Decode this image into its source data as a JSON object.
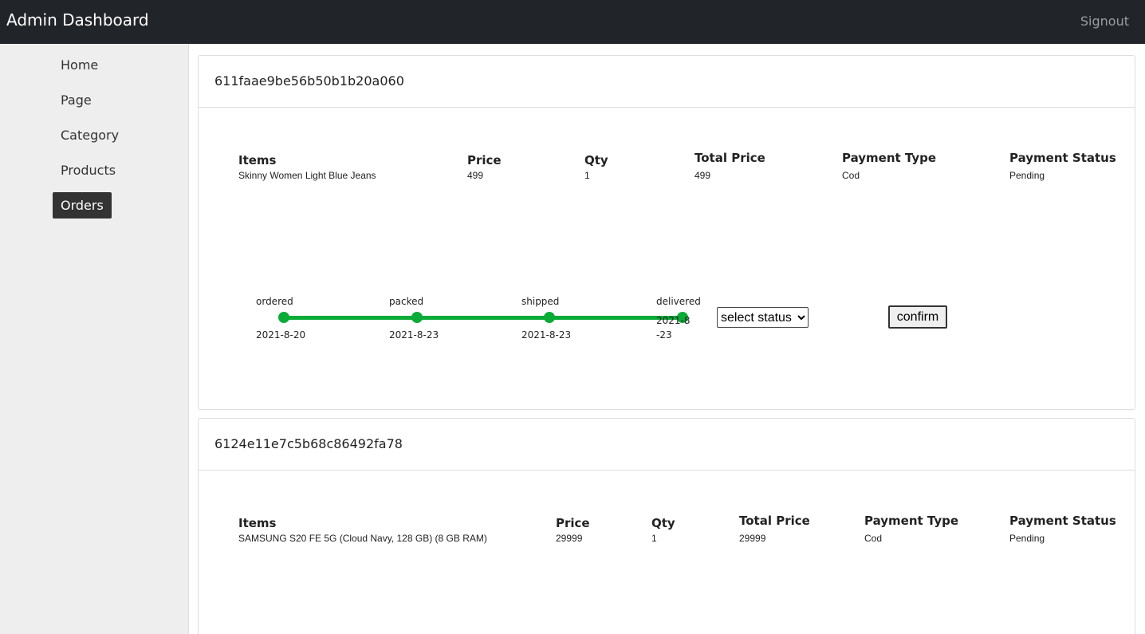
{
  "header": {
    "title": "Admin Dashboard",
    "signout_label": "Signout"
  },
  "sidebar": {
    "items": [
      {
        "label": "Home",
        "active": false
      },
      {
        "label": "Page",
        "active": false
      },
      {
        "label": "Category",
        "active": false
      },
      {
        "label": "Products",
        "active": false
      },
      {
        "label": "Orders",
        "active": true
      }
    ]
  },
  "columns": {
    "items": "Items",
    "price": "Price",
    "qty": "Qty",
    "total_price": "Total Price",
    "payment_type": "Payment Type",
    "payment_status": "Payment Status"
  },
  "orders": [
    {
      "id": "611faae9be56b50b1b20a060",
      "item_name": "Skinny Women Light Blue Jeans",
      "price": "499",
      "qty": "1",
      "total_price": "499",
      "payment_type": "Cod",
      "payment_status": "Pending",
      "tracking": [
        {
          "label": "ordered",
          "date": "2021-8-20"
        },
        {
          "label": "packed",
          "date": "2021-8-23"
        },
        {
          "label": "shipped",
          "date": "2021-8-23"
        },
        {
          "label": "delivered",
          "date": "2021-8-23"
        }
      ],
      "select_placeholder": "select status",
      "confirm_label": "confirm"
    },
    {
      "id": "6124e11e7c5b68c86492fa78",
      "item_name": "SAMSUNG S20 FE 5G (Cloud Navy, 128 GB) (8 GB RAM)",
      "price": "29999",
      "qty": "1",
      "total_price": "29999",
      "payment_type": "Cod",
      "payment_status": "Pending"
    }
  ],
  "colors": {
    "topbar": "#212529",
    "accent_green": "#0aab36",
    "sidebar": "#eeeeee"
  }
}
